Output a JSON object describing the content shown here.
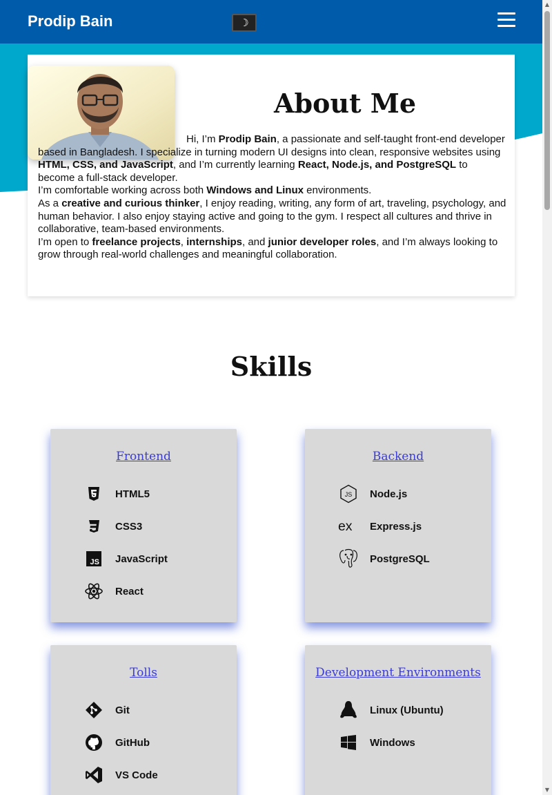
{
  "header": {
    "brand": "Prodip Bain",
    "theme_toggle_icon": "☽",
    "menu_icon": "hamburger-icon"
  },
  "about": {
    "title": "About Me",
    "paragraphs": [
      [
        "Hi, I’m ",
        "Prodip Bain",
        ", a passionate and self-taught front-end developer based in Bangladesh. I specialize in turning modern UI designs into clean, responsive websites using ",
        "HTML, CSS, and JavaScript",
        ", and I’m currently learning ",
        "React, Node.js, and PostgreSQL",
        " to become a full-stack developer."
      ],
      [
        "I’m comfortable working across both ",
        "Windows and Linux",
        " environments."
      ],
      [
        "As a ",
        "creative and curious thinker",
        ", I enjoy reading, writing, any form of art, traveling, psychology, and human behavior. I also enjoy staying active and going to the gym. I respect all cultures and thrive in collaborative, team-based environments."
      ],
      [
        "I’m open to ",
        "freelance projects",
        ", ",
        "internships",
        ", and ",
        "junior developer roles",
        ", and I’m always looking to grow through real-world challenges and meaningful collaboration."
      ]
    ]
  },
  "skills": {
    "title": "Skills",
    "cards": [
      {
        "title": "Frontend",
        "items": [
          {
            "label": "HTML5",
            "icon": "html5-icon"
          },
          {
            "label": "CSS3",
            "icon": "css3-icon"
          },
          {
            "label": "JavaScript",
            "icon": "javascript-icon"
          },
          {
            "label": "React",
            "icon": "react-icon"
          }
        ]
      },
      {
        "title": "Backend",
        "items": [
          {
            "label": "Node.js",
            "icon": "nodejs-icon"
          },
          {
            "label": "Express.js",
            "icon": "express-icon"
          },
          {
            "label": "PostgreSQL",
            "icon": "postgresql-icon"
          }
        ]
      },
      {
        "title": "Tolls",
        "items": [
          {
            "label": "Git",
            "icon": "git-icon"
          },
          {
            "label": "GitHub",
            "icon": "github-icon"
          },
          {
            "label": "VS Code",
            "icon": "vscode-icon"
          }
        ]
      },
      {
        "title": "Development Environments",
        "items": [
          {
            "label": "Linux (Ubuntu)",
            "icon": "linux-icon"
          },
          {
            "label": "Windows",
            "icon": "windows-icon"
          }
        ]
      }
    ]
  },
  "colors": {
    "header_bg": "#005cab",
    "wave": "#00a8cc",
    "card_bg": "#d9d9d9",
    "card_title": "#3b3bd6"
  }
}
